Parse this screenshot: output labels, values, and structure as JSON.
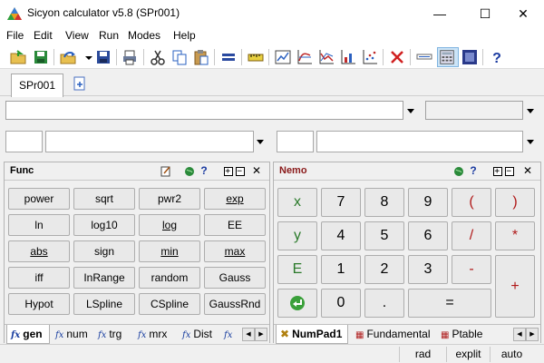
{
  "window": {
    "title": "Sicyon calculator v5.8 (SPr001)",
    "controls": {
      "minimize": "—",
      "maximize": "☐",
      "close": "✕"
    }
  },
  "menu": [
    "File",
    "Edit",
    "View",
    "Run",
    "Modes",
    "Help"
  ],
  "toolbar": {
    "icons": [
      "open-folder-icon",
      "save-icon",
      "open-arrow-icon",
      "dropdown-icon",
      "save-as-icon",
      "print-icon",
      "cut-icon",
      "copy-icon",
      "paste-icon",
      "equals-icon",
      "ruler-icon",
      "chart-icon",
      "chart-xy-icon",
      "chart-bar-icon",
      "chart-scatter-icon",
      "clear-icon",
      "minus-line-icon",
      "calculator-icon",
      "panel-icon",
      "help-icon"
    ]
  },
  "doc_tabs": {
    "active": "SPr001"
  },
  "func_panel": {
    "title": "Func",
    "buttons": [
      [
        "power",
        "sqrt",
        "pwr2",
        "exp"
      ],
      [
        "ln",
        "log10",
        "log",
        "EE"
      ],
      [
        "abs",
        "sign",
        "min",
        "max"
      ],
      [
        "iff",
        "InRange",
        "random",
        "Gauss"
      ],
      [
        "Hypot",
        "LSpline",
        "CSpline",
        "GaussRnd"
      ]
    ],
    "underlined": [
      "exp",
      "log",
      "abs",
      "min",
      "max"
    ],
    "tabs": [
      "gen",
      "num",
      "trg",
      "mrx",
      "Dist",
      "..."
    ],
    "tab_fx": "fx"
  },
  "nemo_panel": {
    "title": "Nemo",
    "rows": [
      [
        "x",
        "7",
        "8",
        "9",
        "(",
        ")"
      ],
      [
        "y",
        "4",
        "5",
        "6",
        "/",
        "*"
      ],
      [
        "E",
        "1",
        "2",
        "3",
        "-",
        "+"
      ],
      [
        "⏎",
        "0",
        ".",
        "="
      ]
    ],
    "tabs": [
      "NumPad1",
      "Fundamental",
      "Ptable"
    ]
  },
  "statusbar": [
    "rad",
    "explit",
    "auto"
  ],
  "colors": {
    "accent_green": "#2a7a2a",
    "accent_red": "#b01818",
    "fx_blue": "#1a3fa0"
  }
}
